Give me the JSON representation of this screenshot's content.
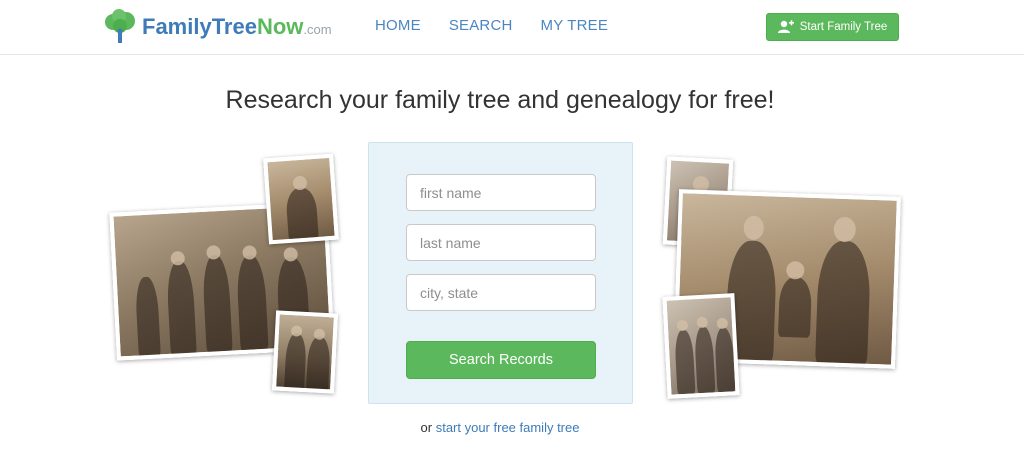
{
  "header": {
    "logo": {
      "family": "Family",
      "tree": "Tree",
      "now": "Now",
      "com": ".com"
    },
    "nav": [
      {
        "label": "HOME"
      },
      {
        "label": "SEARCH"
      },
      {
        "label": "MY TREE"
      }
    ],
    "start_button": {
      "label": "Start Family Tree",
      "icon": "add-user-icon"
    }
  },
  "main": {
    "headline": "Research your family tree and genealogy for free!",
    "search": {
      "first_name_placeholder": "first name",
      "last_name_placeholder": "last name",
      "location_placeholder": "city, state",
      "button_label": "Search Records"
    },
    "footer_prefix": "or",
    "footer_link": "start your free family tree"
  },
  "colors": {
    "brand_blue": "#3e7bb8",
    "brand_green": "#5cb85c",
    "card_bg": "#e8f3f9"
  }
}
